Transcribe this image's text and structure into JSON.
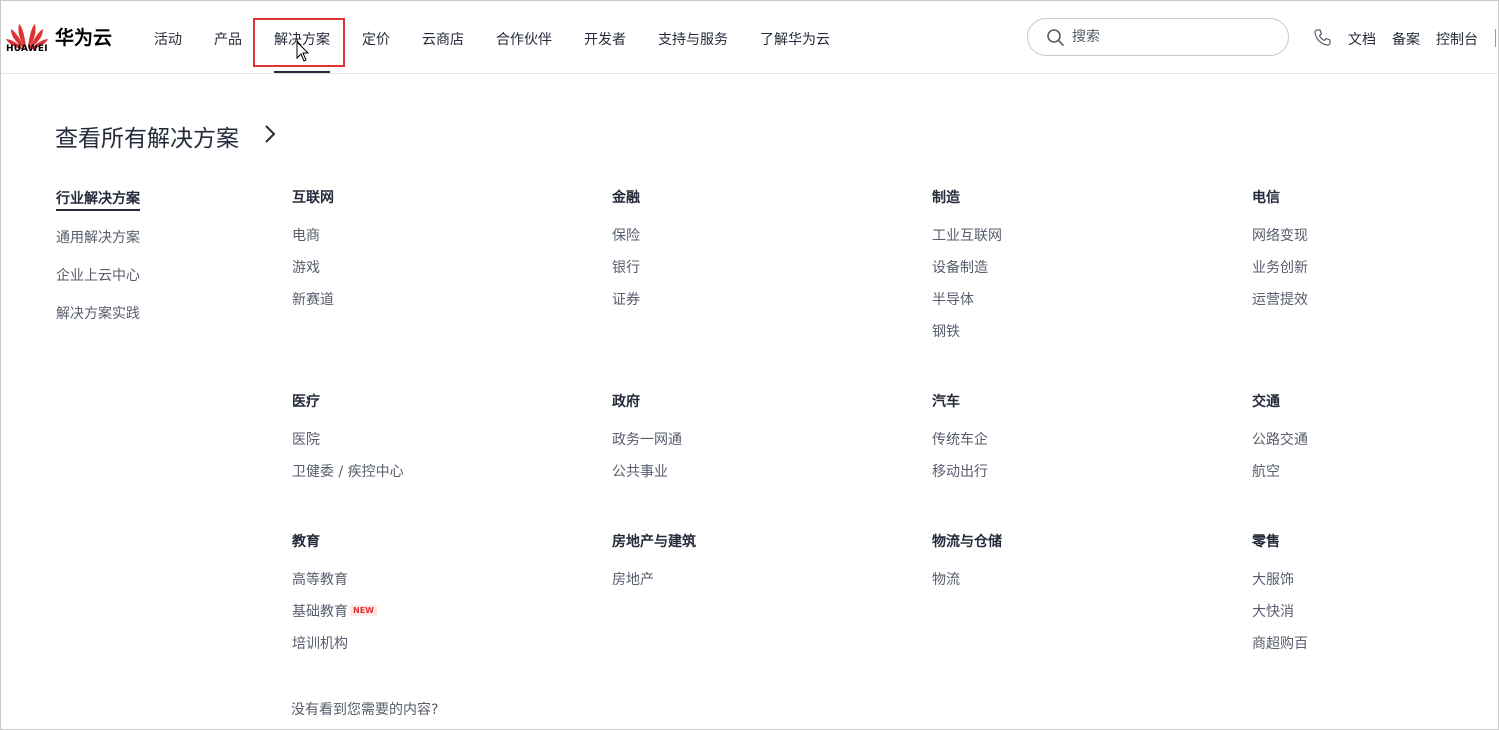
{
  "header": {
    "brand": "华为云",
    "logo_word": "HUAWEI",
    "nav": [
      "活动",
      "产品",
      "解决方案",
      "定价",
      "云商店",
      "合作伙伴",
      "开发者",
      "支持与服务",
      "了解华为云"
    ],
    "search_placeholder": "搜索",
    "utilities": [
      "文档",
      "备案",
      "控制台"
    ]
  },
  "main": {
    "view_all": "查看所有解决方案",
    "sidebar": [
      "行业解决方案",
      "通用解决方案",
      "企业上云中心",
      "解决方案实践"
    ],
    "categories": [
      {
        "title": "互联网",
        "links": [
          "电商",
          "游戏",
          "新赛道"
        ]
      },
      {
        "title": "金融",
        "links": [
          "保险",
          "银行",
          "证券"
        ]
      },
      {
        "title": "制造",
        "links": [
          "工业互联网",
          "设备制造",
          "半导体",
          "钢铁"
        ]
      },
      {
        "title": "电信",
        "links": [
          "网络变现",
          "业务创新",
          "运营提效"
        ]
      },
      {
        "title": "医疗",
        "links": [
          "医院",
          "卫健委 / 疾控中心"
        ]
      },
      {
        "title": "政府",
        "links": [
          "政务一网通",
          "公共事业"
        ]
      },
      {
        "title": "汽车",
        "links": [
          "传统车企",
          "移动出行"
        ]
      },
      {
        "title": "交通",
        "links": [
          "公路交通",
          "航空"
        ]
      },
      {
        "title": "教育",
        "links": [
          "高等教育",
          "基础教育",
          "培训机构"
        ]
      },
      {
        "title": "房地产与建筑",
        "links": [
          "房地产"
        ]
      },
      {
        "title": "物流与仓储",
        "links": [
          "物流"
        ]
      },
      {
        "title": "零售",
        "links": [
          "大服饰",
          "大快消",
          "商超购百"
        ]
      }
    ],
    "new_badge": "NEW",
    "bottom_note": "没有看到您需要的内容?"
  },
  "colors": {
    "brand_red": "#e03232",
    "text_primary": "#252b3a",
    "text_secondary": "#575d6c"
  },
  "icons": [
    "huawei-logo",
    "search-icon",
    "phone-icon",
    "chevron-right-icon",
    "cursor-icon"
  ]
}
